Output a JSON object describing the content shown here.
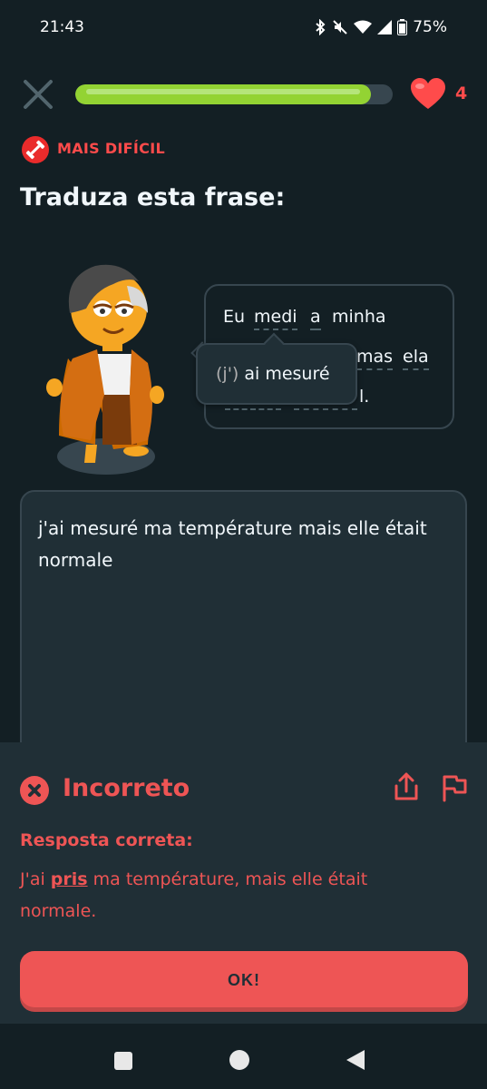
{
  "status_bar": {
    "time": "21:43",
    "battery": "75%",
    "icons": [
      "bluetooth-icon",
      "silent-icon",
      "wifi-icon",
      "signal-icon",
      "battery-icon"
    ]
  },
  "top_bar": {
    "progress": 0.93,
    "hearts": "4"
  },
  "challenge": {
    "badge": "MAIS DIFÍCIL",
    "title": "Traduza esta frase:"
  },
  "sentence": {
    "line1": [
      "Eu",
      "medi",
      "a",
      "minha"
    ],
    "line2_visible": [
      "mas",
      "ela"
    ],
    "line3_end": "l."
  },
  "tooltip": {
    "prefix": "(j')",
    "text": "ai mesuré"
  },
  "answer": {
    "text": "j'ai mesuré ma température mais elle était normale"
  },
  "feedback": {
    "title": "Incorreto",
    "subtitle": "Resposta correta:",
    "answer_pre": "J'ai ",
    "answer_highlight": "pris",
    "answer_post": " ma température, mais elle était normale."
  },
  "button": {
    "ok": "OK!"
  },
  "colors": {
    "background": "#131f24",
    "panel": "#202f36",
    "error": "#ee5555",
    "progress": "#93d333",
    "heart": "#ff4b4b"
  }
}
